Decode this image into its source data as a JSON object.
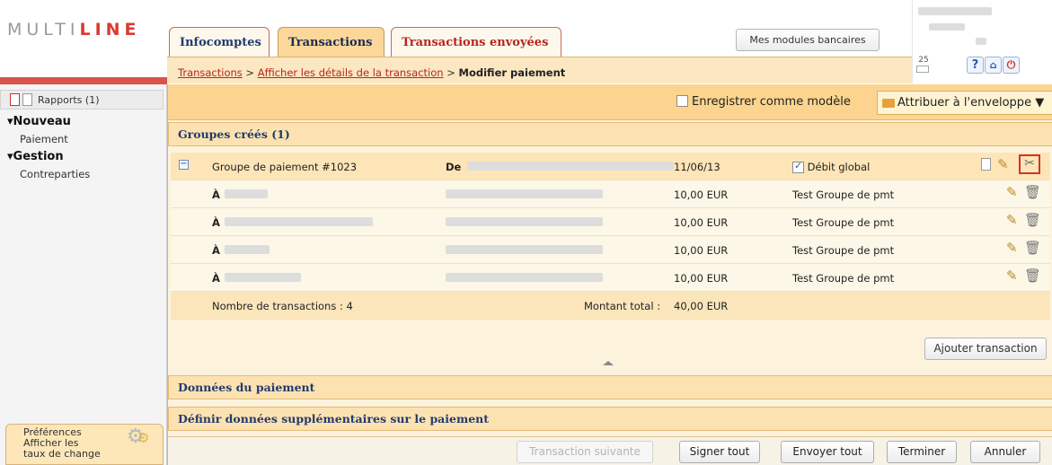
{
  "app": {
    "logo_part1": "MULTI",
    "logo_part2": "LINE"
  },
  "tabs": [
    {
      "label": "Infocomptes",
      "active": false
    },
    {
      "label": "Transactions",
      "active": true
    },
    {
      "label": "Transactions envoyées",
      "active": false
    }
  ],
  "header": {
    "modules_button": "Mes modules bancaires",
    "calendar_day": "25",
    "help_label": "?"
  },
  "breadcrumb": {
    "items": [
      "Transactions",
      "Afficher les détails de la transaction"
    ],
    "separator": " > ",
    "current": "Modifier paiement"
  },
  "sidebar": {
    "reports": "Rapports (1)",
    "sections": [
      {
        "title": "Nouveau",
        "items": [
          "Paiement"
        ]
      },
      {
        "title": "Gestion",
        "items": [
          "Contreparties"
        ]
      }
    ],
    "preferences": [
      "Préférences",
      "Afficher les",
      "taux de change"
    ]
  },
  "toolbar": {
    "save_template": "Enregistrer comme modèle",
    "save_template_checked": false,
    "assign_envelope": "Attribuer à l'enveloppe ▼"
  },
  "groups": {
    "title": "Groupes créés (1)",
    "header": {
      "name": "Groupe de paiement #1023",
      "from_label": "De",
      "date": "11/06/13",
      "global_debit": "Débit global",
      "global_debit_checked": true
    },
    "rows": [
      {
        "to_label": "À",
        "amount": "10,00 EUR",
        "reference": "Test Groupe de pmt"
      },
      {
        "to_label": "À",
        "amount": "10,00 EUR",
        "reference": "Test Groupe de pmt"
      },
      {
        "to_label": "À",
        "amount": "10,00 EUR",
        "reference": "Test Groupe de pmt"
      },
      {
        "to_label": "À",
        "amount": "10,00 EUR",
        "reference": "Test Groupe de pmt"
      }
    ],
    "footer": {
      "count": "Nombre de transactions : 4",
      "total_label": "Montant total :",
      "total_value": "40,00 EUR"
    }
  },
  "add_transaction": "Ajouter transaction",
  "payment_data": "Données du paiement",
  "extra_data": "Définir données supplémentaires sur le paiement",
  "footer_buttons": {
    "next": "Transaction suivante",
    "sign_all": "Signer tout",
    "send_all": "Envoyer tout",
    "finish": "Terminer",
    "cancel": "Annuler"
  },
  "colors": {
    "accent_red": "#d93b30",
    "tab_active": "#fbd89a",
    "toolbar": "#fcd48f",
    "link": "#b7261d",
    "section_title": "#223a70"
  },
  "icons": [
    "pdf-icon",
    "document-icon",
    "gear-icon",
    "folder-icon",
    "collapse-icon",
    "edit-icon",
    "tools-icon",
    "delete-icon",
    "help-icon",
    "home-icon",
    "logout-icon",
    "calendar-icon"
  ]
}
